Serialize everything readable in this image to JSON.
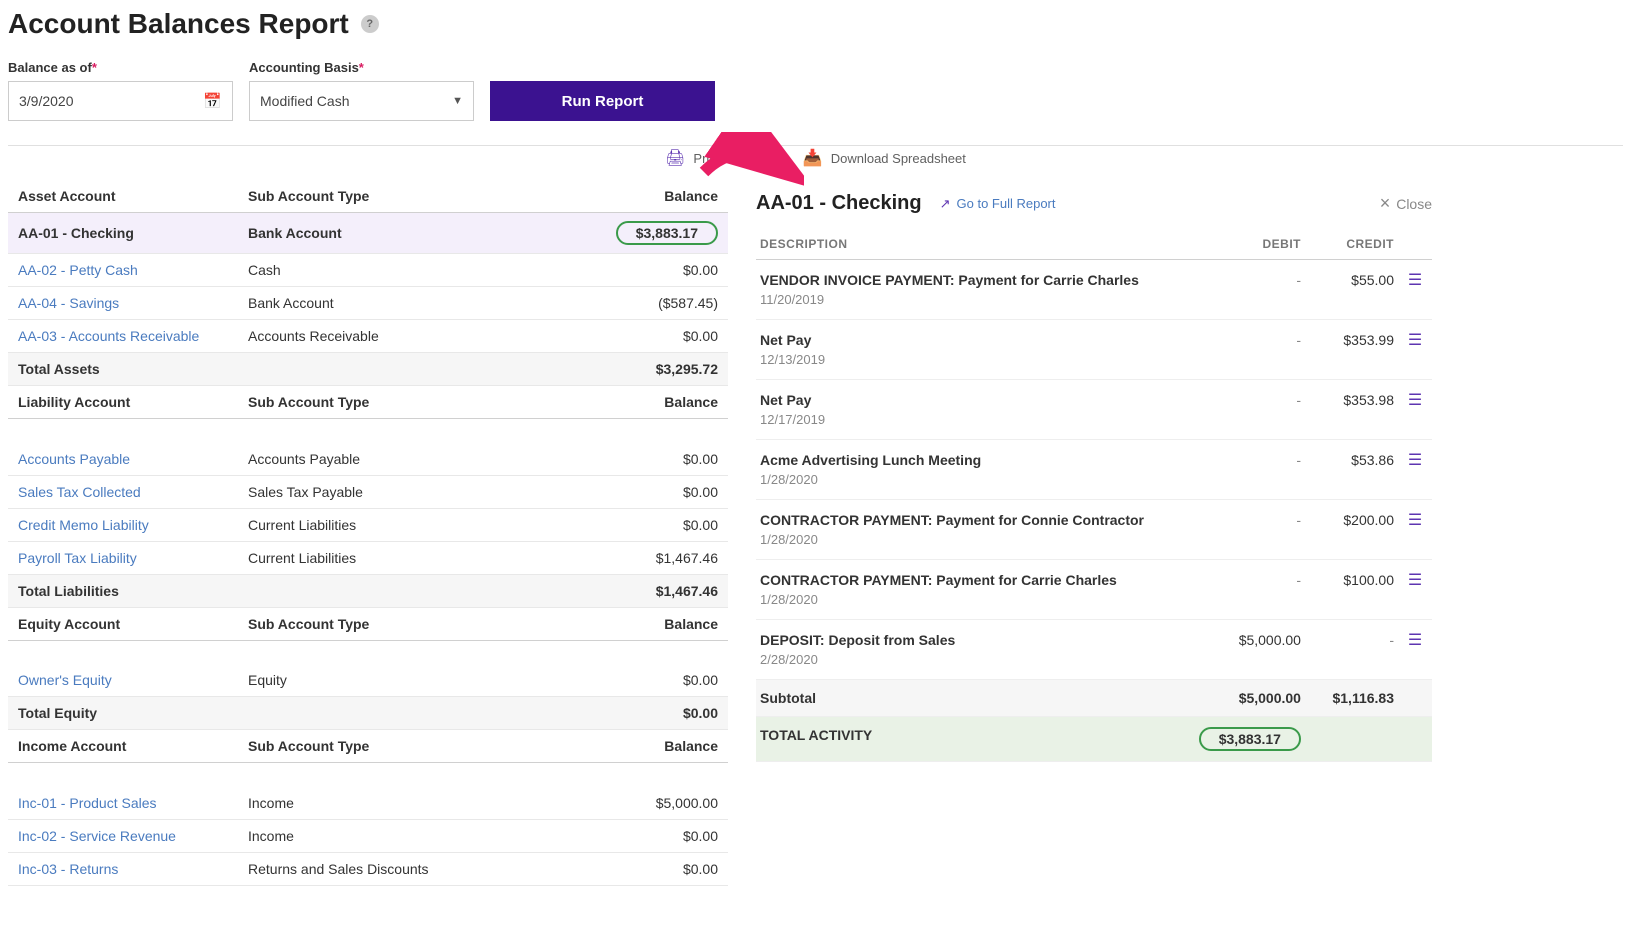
{
  "header": {
    "title": "Account Balances Report"
  },
  "filters": {
    "balance_label": "Balance as of",
    "balance_value": "3/9/2020",
    "basis_label": "Accounting Basis",
    "basis_value": "Modified Cash",
    "run_label": "Run Report"
  },
  "toolbar": {
    "print_label": "Print Report",
    "download_label": "Download Spreadsheet"
  },
  "columns": {
    "asset": "Asset Account",
    "liab": "Liability Account",
    "equity": "Equity Account",
    "income": "Income Account",
    "sub": "Sub Account Type",
    "balance": "Balance"
  },
  "assets": {
    "rows": [
      {
        "name": "AA-01 - Checking",
        "sub": "Bank Account",
        "balance": "$3,883.17",
        "highlight": true
      },
      {
        "name": "AA-02 - Petty Cash",
        "sub": "Cash",
        "balance": "$0.00"
      },
      {
        "name": "AA-04 - Savings",
        "sub": "Bank Account",
        "balance": "($587.45)"
      },
      {
        "name": "AA-03 - Accounts Receivable",
        "sub": "Accounts Receivable",
        "balance": "$0.00"
      }
    ],
    "total_label": "Total Assets",
    "total_value": "$3,295.72"
  },
  "liabilities": {
    "rows": [
      {
        "name": "Accounts Payable",
        "sub": "Accounts Payable",
        "balance": "$0.00"
      },
      {
        "name": "Sales Tax Collected",
        "sub": "Sales Tax Payable",
        "balance": "$0.00"
      },
      {
        "name": "Credit Memo Liability",
        "sub": "Current Liabilities",
        "balance": "$0.00"
      },
      {
        "name": "Payroll Tax Liability",
        "sub": "Current Liabilities",
        "balance": "$1,467.46"
      }
    ],
    "total_label": "Total Liabilities",
    "total_value": "$1,467.46"
  },
  "equity": {
    "rows": [
      {
        "name": "Owner's Equity",
        "sub": "Equity",
        "balance": "$0.00"
      }
    ],
    "total_label": "Total Equity",
    "total_value": "$0.00"
  },
  "income": {
    "rows": [
      {
        "name": "Inc-01 - Product Sales",
        "sub": "Income",
        "balance": "$5,000.00"
      },
      {
        "name": "Inc-02 - Service Revenue",
        "sub": "Income",
        "balance": "$0.00"
      },
      {
        "name": "Inc-03 - Returns",
        "sub": "Returns and Sales Discounts",
        "balance": "$0.00"
      }
    ]
  },
  "panel": {
    "title": "AA-01 - Checking",
    "full_report": "Go to Full Report",
    "close": "Close",
    "cols": {
      "desc": "DESCRIPTION",
      "debit": "DEBIT",
      "credit": "CREDIT"
    },
    "rows": [
      {
        "desc": "VENDOR INVOICE PAYMENT: Payment for Carrie Charles",
        "date": "11/20/2019",
        "debit": "-",
        "credit": "$55.00"
      },
      {
        "desc": "Net Pay",
        "date": "12/13/2019",
        "debit": "-",
        "credit": "$353.99"
      },
      {
        "desc": "Net Pay",
        "date": "12/17/2019",
        "debit": "-",
        "credit": "$353.98"
      },
      {
        "desc": "Acme Advertising Lunch Meeting",
        "date": "1/28/2020",
        "debit": "-",
        "credit": "$53.86"
      },
      {
        "desc": "CONTRACTOR PAYMENT: Payment for Connie Contractor",
        "date": "1/28/2020",
        "debit": "-",
        "credit": "$200.00"
      },
      {
        "desc": "CONTRACTOR PAYMENT: Payment for Carrie Charles",
        "date": "1/28/2020",
        "debit": "-",
        "credit": "$100.00"
      },
      {
        "desc": "DEPOSIT: Deposit from Sales",
        "date": "2/28/2020",
        "debit": "$5,000.00",
        "credit": "-"
      }
    ],
    "subtotal_label": "Subtotal",
    "subtotal_debit": "$5,000.00",
    "subtotal_credit": "$1,116.83",
    "total_label": "TOTAL ACTIVITY",
    "total_value": "$3,883.17"
  }
}
